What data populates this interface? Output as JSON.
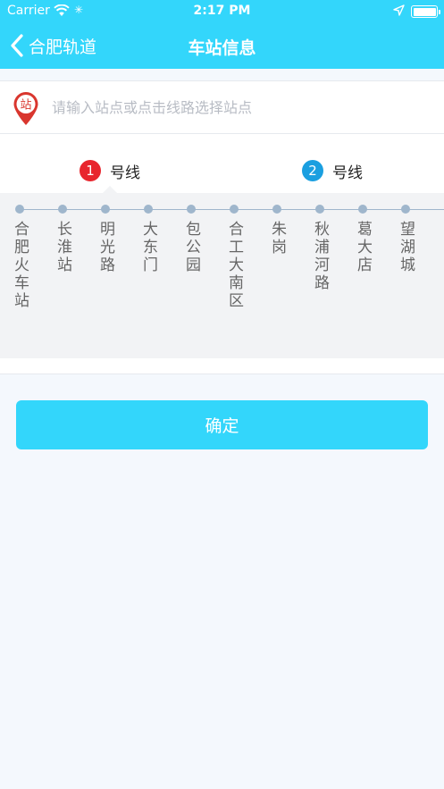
{
  "status_bar": {
    "carrier": "Carrier",
    "time": "2:17 PM"
  },
  "nav": {
    "back_label": "合肥轨道",
    "title": "车站信息"
  },
  "search": {
    "pin_label": "站",
    "placeholder": "请输入站点或点击线路选择站点"
  },
  "lines": [
    {
      "number": "1",
      "label": "号线",
      "color": "#e8252d",
      "selected": true
    },
    {
      "number": "2",
      "label": "号线",
      "color": "#1a9fe0",
      "selected": false
    }
  ],
  "stations": [
    "合肥火车站",
    "长淮站",
    "明光路",
    "大东门",
    "包公园",
    "合工大南区",
    "朱岗",
    "秋浦河路",
    "葛大店",
    "望湖城"
  ],
  "confirm_label": "确定",
  "colors": {
    "accent": "#33d6fb",
    "line1": "#e8252d",
    "line2": "#1a9fe0",
    "route": "#9fb6cc"
  }
}
